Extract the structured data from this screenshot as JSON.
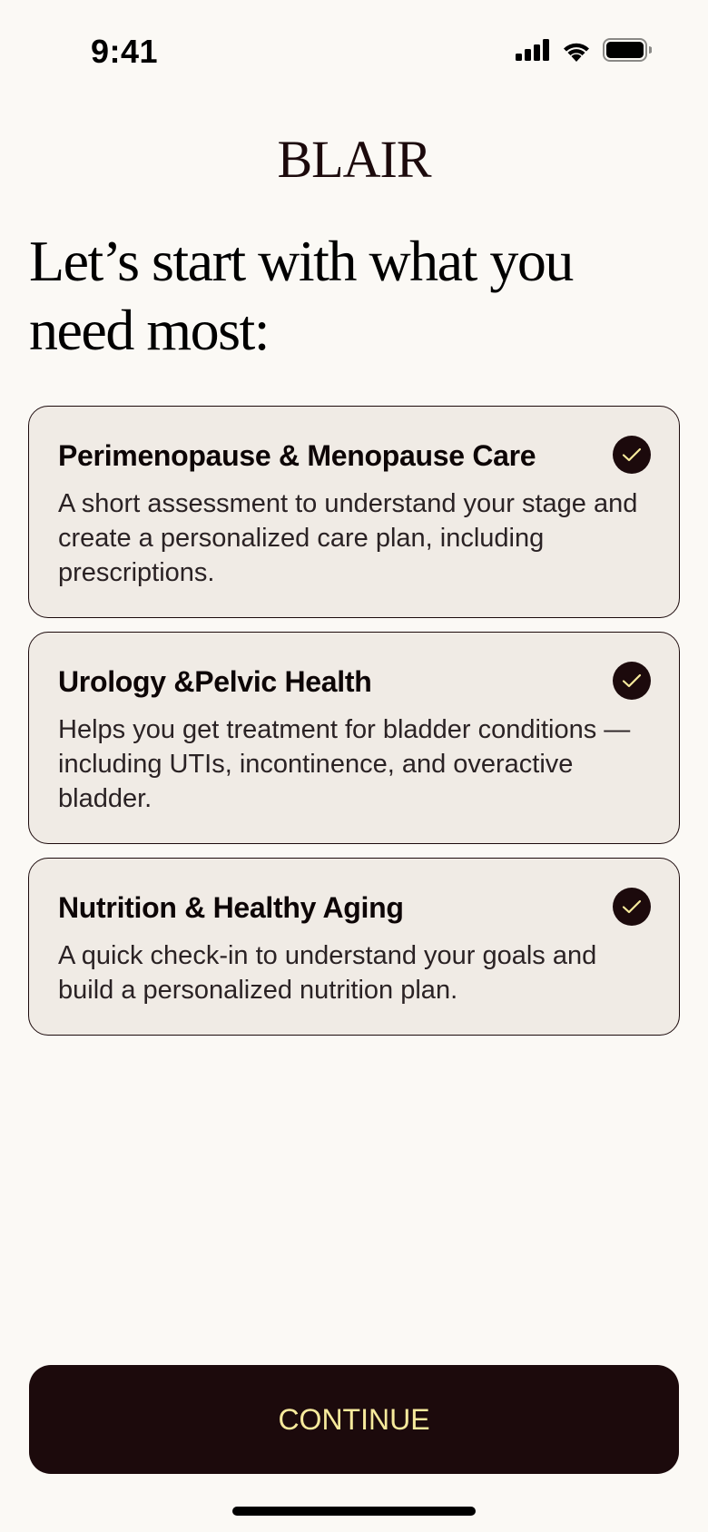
{
  "status_bar": {
    "time": "9:41",
    "icons": [
      "cellular-signal-icon",
      "wifi-icon",
      "battery-icon"
    ]
  },
  "logo": "BLAIR",
  "heading": "Let’s start with what you need most:",
  "options": [
    {
      "title": "Perimenopause & Menopause Care",
      "description": "A short assessment to understand your stage and create a personalized care plan, including prescriptions.",
      "selected": true
    },
    {
      "title": "Urology &Pelvic Health",
      "description": "Helps you get treatment for bladder conditions — including UTIs, incontinence, and overactive bladder.",
      "selected": true
    },
    {
      "title": "Nutrition & Healthy Aging",
      "description": "A quick check-in to understand your goals and build a personalized nutrition plan.",
      "selected": true
    }
  ],
  "continue_label": "CONTINUE",
  "colors": {
    "background": "#fbf9f5",
    "card": "#f0ebe5",
    "primary": "#1c0a0c",
    "button_text": "#f7ea9c"
  }
}
